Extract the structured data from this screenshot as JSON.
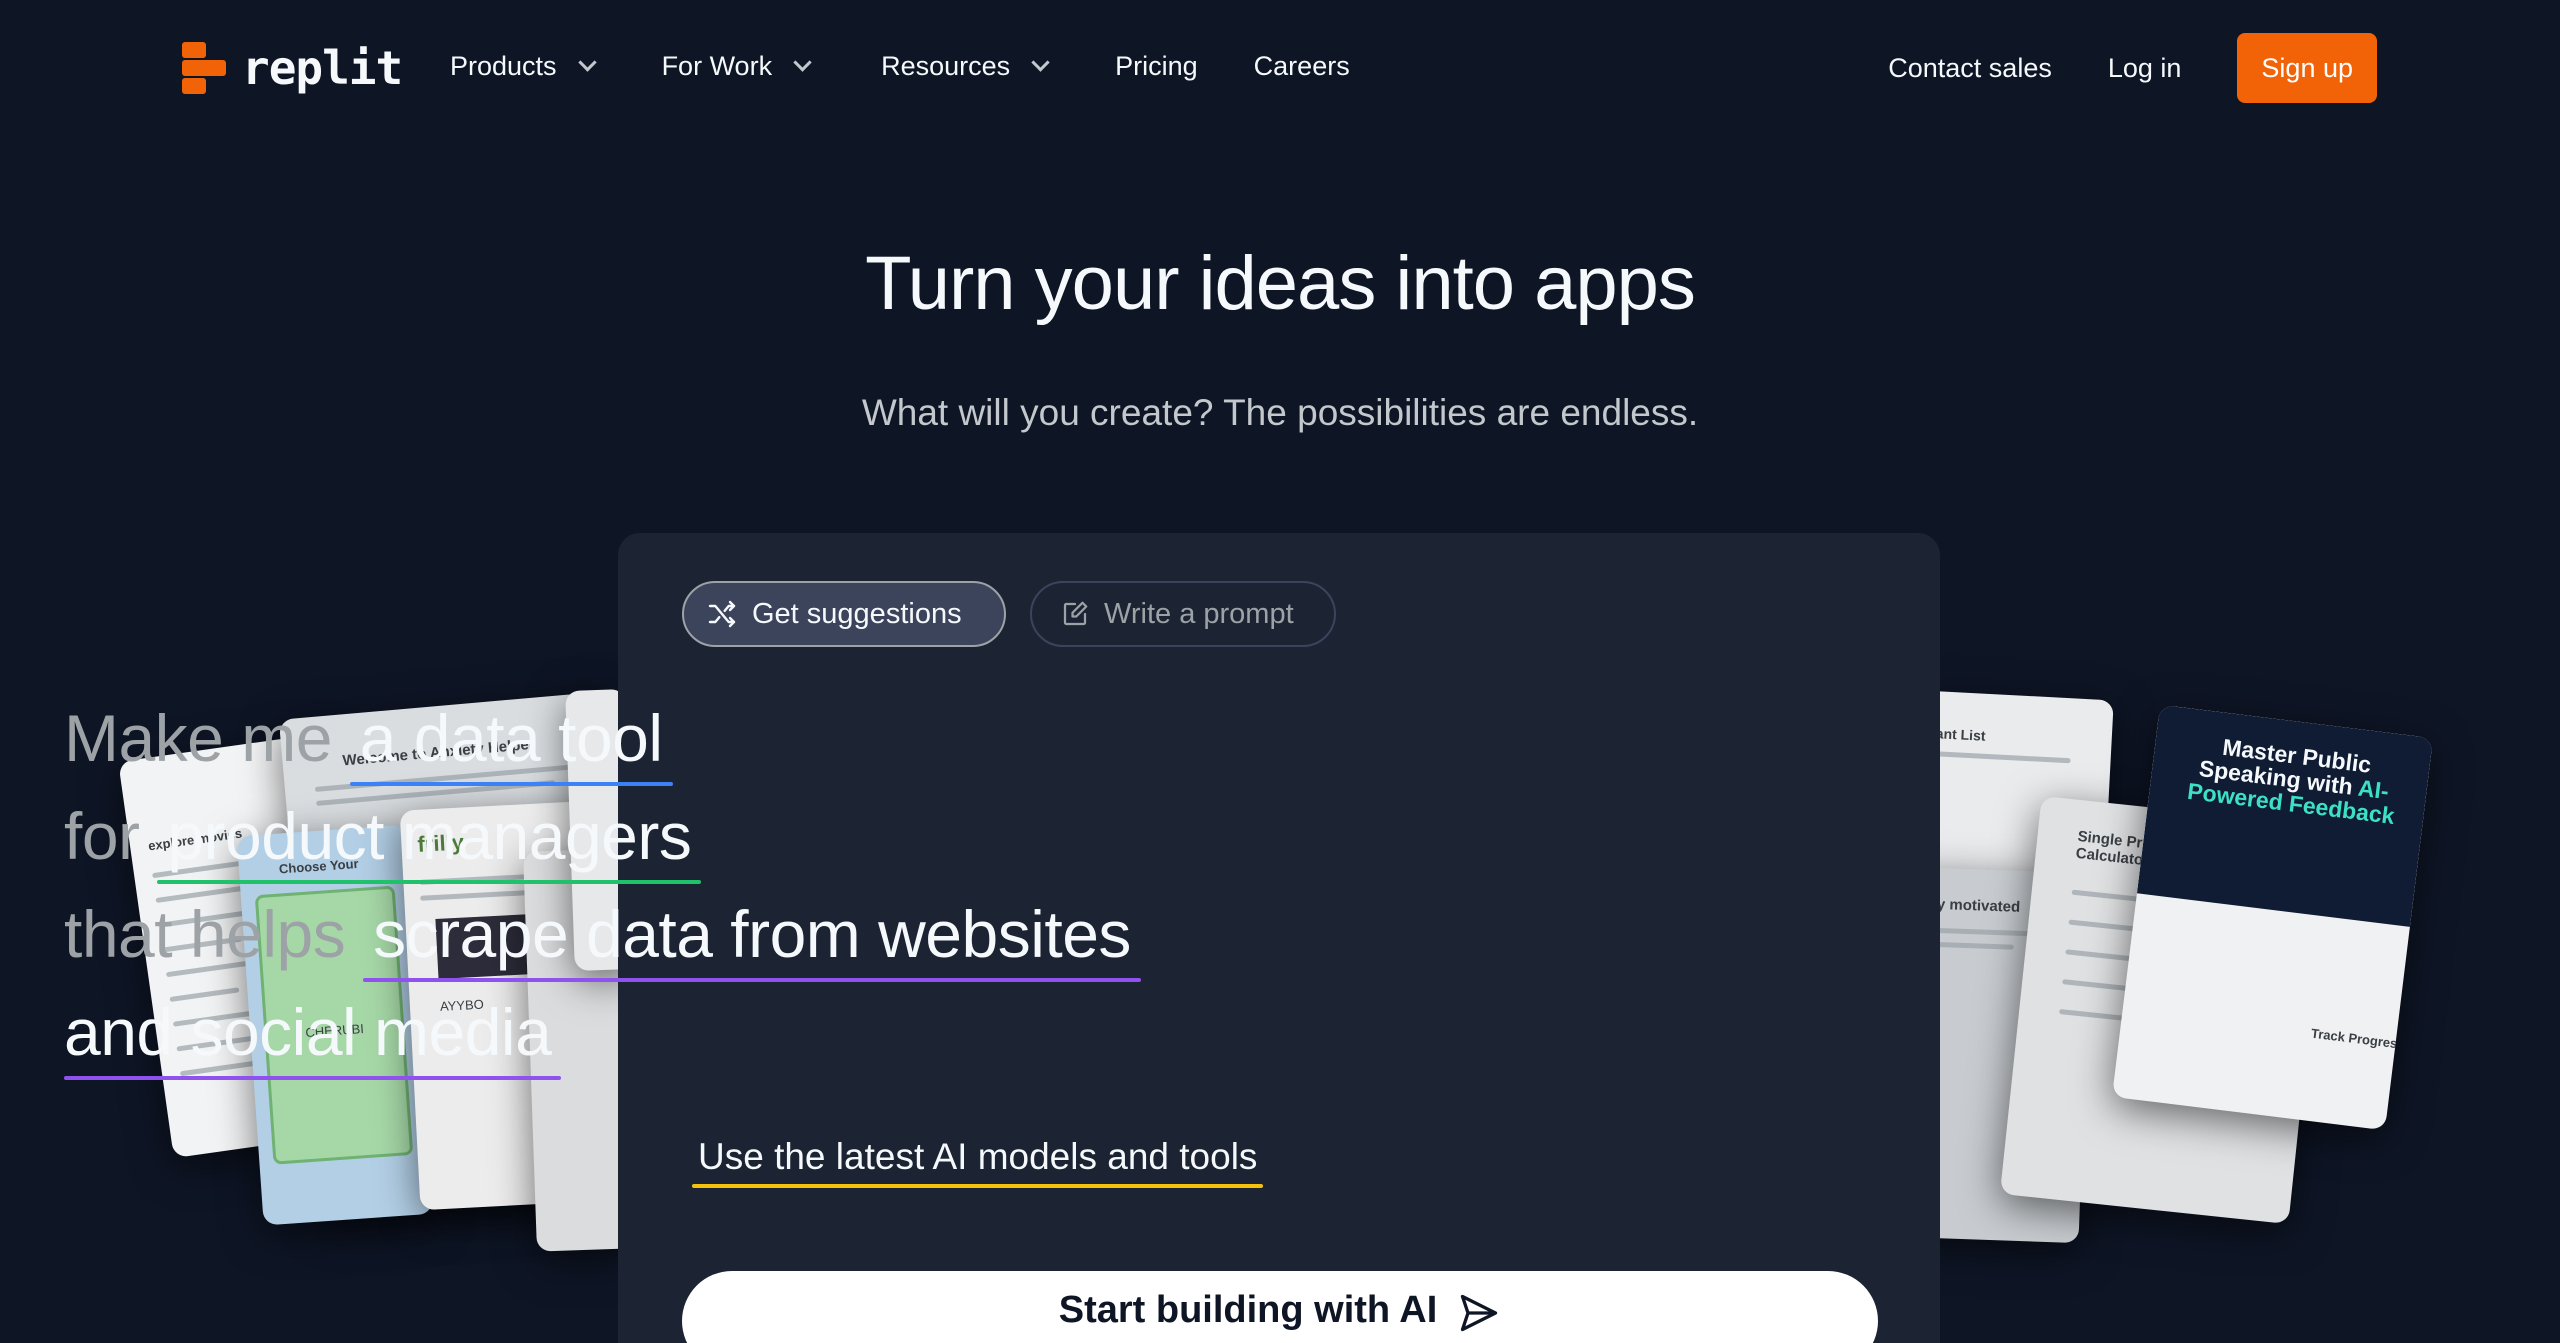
{
  "brand": {
    "name": "replit",
    "accent": "#f26207"
  },
  "nav": {
    "products": "Products",
    "for_work": "For Work",
    "resources": "Resources",
    "pricing": "Pricing",
    "careers": "Careers",
    "contact_sales": "Contact sales",
    "login": "Log in",
    "signup": "Sign up"
  },
  "hero": {
    "title": "Turn your ideas into apps",
    "subtitle": "What will you create? The possibilities are endless."
  },
  "panel": {
    "chip_suggest": "Get suggestions",
    "chip_write": "Write a prompt",
    "prompt": {
      "prefix1": "Make me",
      "value1": "a data tool",
      "prefix2": "for",
      "value2": "product managers",
      "prefix3": "that helps",
      "value3": "scrape data from websites",
      "value4": "and social media"
    },
    "ai_line": "Use the latest AI models and tools",
    "start_button": "Start building with AI"
  },
  "preview_cards": {
    "anxiety": "Welcome to Anxiety Helper",
    "movies": "explore movies",
    "choose": "Choose Your",
    "cherubi": "CHERUBI",
    "frilly": "frilly",
    "ayybo": "AYYBO",
    "grant": "grant List",
    "motivated": "stay motivated",
    "loan": "Single Property Loan Calculator",
    "speaking_1": "Master Public Speaking with",
    "speaking_2": "AI-Powered Feedback",
    "track": "Track Progress"
  }
}
